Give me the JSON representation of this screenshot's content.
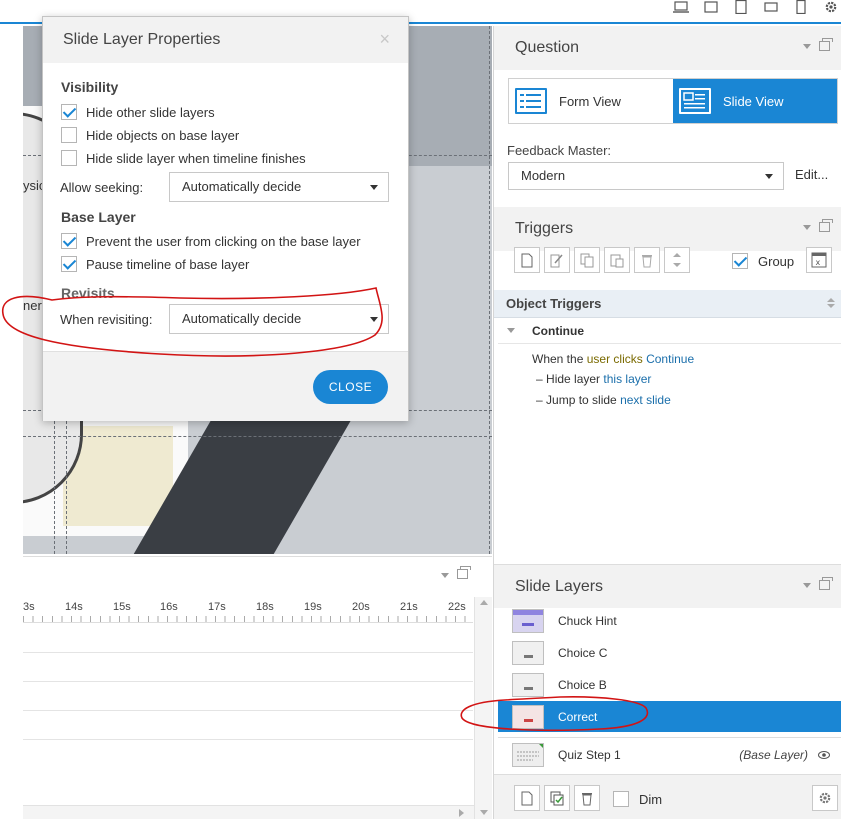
{
  "dialog": {
    "title": "Slide Layer Properties",
    "close_x": "×",
    "visibility": {
      "heading": "Visibility",
      "options": [
        {
          "label": "Hide other slide layers",
          "checked": true
        },
        {
          "label": "Hide objects on base layer",
          "checked": false
        },
        {
          "label": "Hide slide layer when timeline finishes",
          "checked": false
        }
      ],
      "allow_seeking_label": "Allow seeking:",
      "allow_seeking_value": "Automatically decide"
    },
    "base_layer": {
      "heading": "Base Layer",
      "options": [
        {
          "label": "Prevent the user from clicking on the base layer",
          "checked": true
        },
        {
          "label": "Pause timeline of base layer",
          "checked": true
        }
      ]
    },
    "revisits": {
      "heading": "Revisits",
      "when_revisiting_label": "When revisiting:",
      "when_revisiting_value": "Automatically decide"
    },
    "close_button": "CLOSE"
  },
  "stage": {
    "fragment_top": "ysic",
    "fragment_mid": "ner"
  },
  "timeline": {
    "ruler_labels": [
      "3s",
      "14s",
      "15s",
      "16s",
      "17s",
      "18s",
      "19s",
      "20s",
      "21s",
      "22s"
    ]
  },
  "question_panel": {
    "title": "Question",
    "form_view": "Form View",
    "slide_view": "Slide View",
    "feedback_master_label": "Feedback Master:",
    "feedback_master_value": "Modern",
    "edit_link": "Edit..."
  },
  "triggers_panel": {
    "title": "Triggers",
    "group_label": "Group",
    "group_checked": true,
    "object_triggers_heading": "Object Triggers",
    "continue_group": "Continue",
    "trigger": {
      "when": "When the",
      "user": "user",
      "clicks": "clicks",
      "object": "Continue",
      "actions": [
        {
          "verb": "Hide layer",
          "target": "this layer"
        },
        {
          "verb": "Jump to slide",
          "target": "next slide"
        }
      ]
    }
  },
  "slide_layers_panel": {
    "title": "Slide Layers",
    "layers": [
      {
        "name": "Chuck Hint",
        "selected": false
      },
      {
        "name": "Choice C",
        "selected": false
      },
      {
        "name": "Choice B",
        "selected": false
      },
      {
        "name": "Correct",
        "selected": true
      }
    ],
    "base_layer": {
      "name": "Quiz Step 1",
      "tag": "(Base Layer)"
    },
    "dim_label": "Dim"
  },
  "colors": {
    "accent": "#1a86d4",
    "annotation": "#d21414"
  }
}
